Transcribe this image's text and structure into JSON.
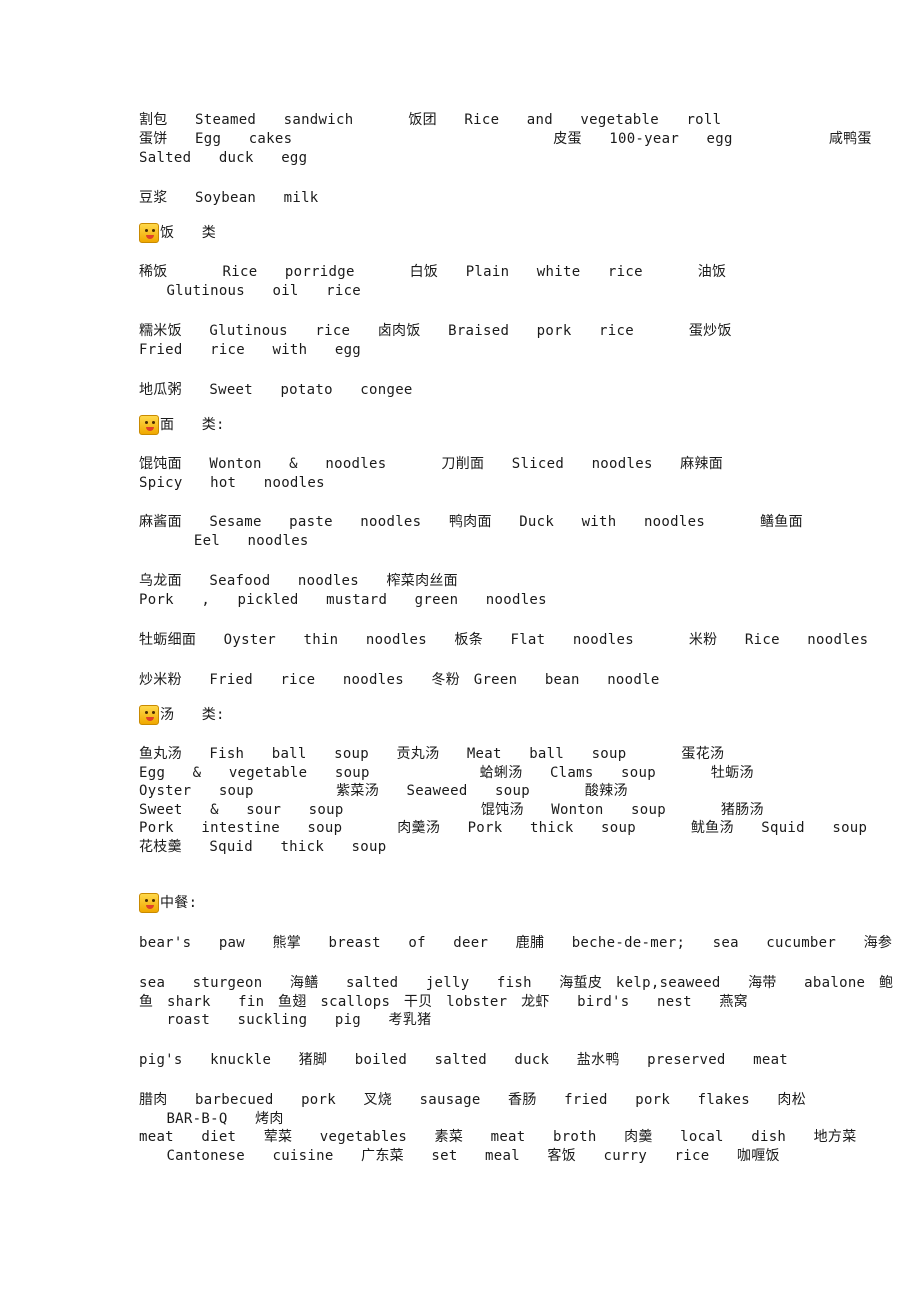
{
  "lines": {
    "l1": "割包  Steamed  sandwich    饭团  Rice  and  vegetable  roll",
    "l2": "蛋饼  Egg  cakes                   皮蛋  100-year  egg       咸鸭蛋",
    "l3": "Salted  duck  egg",
    "l4": "豆浆  Soybean  milk",
    "rice_heading": "饭  类",
    "r1": "稀饭    Rice  porridge    白饭  Plain  white  rice    油饭",
    "r2": "  Glutinous  oil  rice",
    "r3": "糯米饭  Glutinous  rice  卤肉饭  Braised  pork  rice    蛋炒饭",
    "r4": "Fried  rice  with  egg",
    "r5": "地瓜粥  Sweet  potato  congee",
    "noodle_heading": "面  类:",
    "n1": "馄饨面  Wonton  &  noodles    刀削面  Sliced  noodles  麻辣面",
    "n2": "Spicy  hot  noodles",
    "n3": "麻酱面  Sesame  paste  noodles  鸭肉面  Duck  with  noodles    鳝鱼面",
    "n4": "    Eel  noodles",
    "n5": "乌龙面  Seafood  noodles  榨菜肉丝面",
    "n6": "Pork  ,  pickled  mustard  green  noodles",
    "n7": "牡蛎细面  Oyster  thin  noodles  板条  Flat  noodles    米粉  Rice  noodles",
    "n8": "炒米粉  Fried  rice  noodles  冬粉 Green  bean  noodle",
    "soup_heading": "汤  类:",
    "s1": "鱼丸汤  Fish  ball  soup  贡丸汤  Meat  ball  soup    蛋花汤",
    "s2": "Egg  &  vegetable  soup        蛤蜊汤  Clams  soup    牡蛎汤",
    "s3": "Oyster  soup      紫菜汤  Seaweed  soup    酸辣汤",
    "s4": "Sweet  &  sour  soup          馄饨汤  Wonton  soup    猪肠汤",
    "s5": "Pork  intestine  soup    肉羹汤  Pork  thick  soup    鱿鱼汤  Squid  soup",
    "s6": "花枝羹  Squid  thick  soup",
    "chinese_heading": "中餐:",
    "c1": "bear's  paw  熊掌  breast  of  deer  鹿脯  beche-de-mer;  sea  cucumber  海参",
    "c2": "sea  sturgeon  海鳝  salted  jelly  fish  海蜇皮 kelp,seaweed  海带  abalone 鲍",
    "c3": "鱼 shark  fin 鱼翅 scallops 干贝 lobster 龙虾  bird's  nest  燕窝",
    "c4": "  roast  suckling  pig  考乳猪",
    "c5": "pig's  knuckle  猪脚  boiled  salted  duck  盐水鸭  preserved  meat",
    "c6": "腊肉  barbecued  pork  叉烧  sausage  香肠  fried  pork  flakes  肉松",
    "c7": "  BAR-B-Q  烤肉",
    "c8": "meat  diet  荤菜  vegetables  素菜  meat  broth  肉羹  local  dish  地方菜",
    "c9": "  Cantonese  cuisine  广东菜  set  meal  客饭  curry  rice  咖喱饭"
  },
  "icons": {
    "rice": "emoji-face-icon",
    "noodle": "emoji-face-icon",
    "soup": "emoji-face-icon",
    "chinese": "emoji-face-icon"
  }
}
